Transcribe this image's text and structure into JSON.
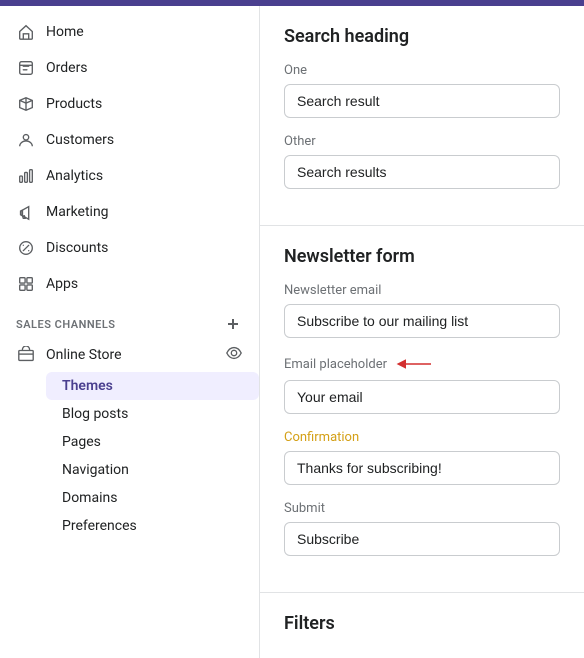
{
  "topbar": {},
  "sidebar": {
    "nav_items": [
      {
        "id": "home",
        "label": "Home",
        "icon": "home"
      },
      {
        "id": "orders",
        "label": "Orders",
        "icon": "orders"
      },
      {
        "id": "products",
        "label": "Products",
        "icon": "products"
      },
      {
        "id": "customers",
        "label": "Customers",
        "icon": "customers"
      },
      {
        "id": "analytics",
        "label": "Analytics",
        "icon": "analytics"
      },
      {
        "id": "marketing",
        "label": "Marketing",
        "icon": "marketing"
      },
      {
        "id": "discounts",
        "label": "Discounts",
        "icon": "discounts"
      },
      {
        "id": "apps",
        "label": "Apps",
        "icon": "apps"
      }
    ],
    "sales_channels_label": "SALES CHANNELS",
    "online_store_label": "Online Store",
    "sub_items": [
      {
        "id": "themes",
        "label": "Themes",
        "active": true
      },
      {
        "id": "blog-posts",
        "label": "Blog posts",
        "active": false
      },
      {
        "id": "pages",
        "label": "Pages",
        "active": false
      },
      {
        "id": "navigation",
        "label": "Navigation",
        "active": false
      },
      {
        "id": "domains",
        "label": "Domains",
        "active": false
      },
      {
        "id": "preferences",
        "label": "Preferences",
        "active": false
      }
    ]
  },
  "main": {
    "search_heading": {
      "title": "Search heading",
      "one_label": "One",
      "one_value": "Search result",
      "other_label": "Other",
      "other_value": "Search results"
    },
    "newsletter_form": {
      "title": "Newsletter form",
      "newsletter_email_label": "Newsletter email",
      "newsletter_email_value": "Subscribe to our mailing list",
      "email_placeholder_label": "Email placeholder",
      "email_placeholder_value": "Your email",
      "confirmation_label": "Confirmation",
      "confirmation_value": "Thanks for subscribing!",
      "submit_label": "Submit",
      "submit_value": "Subscribe"
    },
    "filters": {
      "title": "Filters"
    }
  }
}
